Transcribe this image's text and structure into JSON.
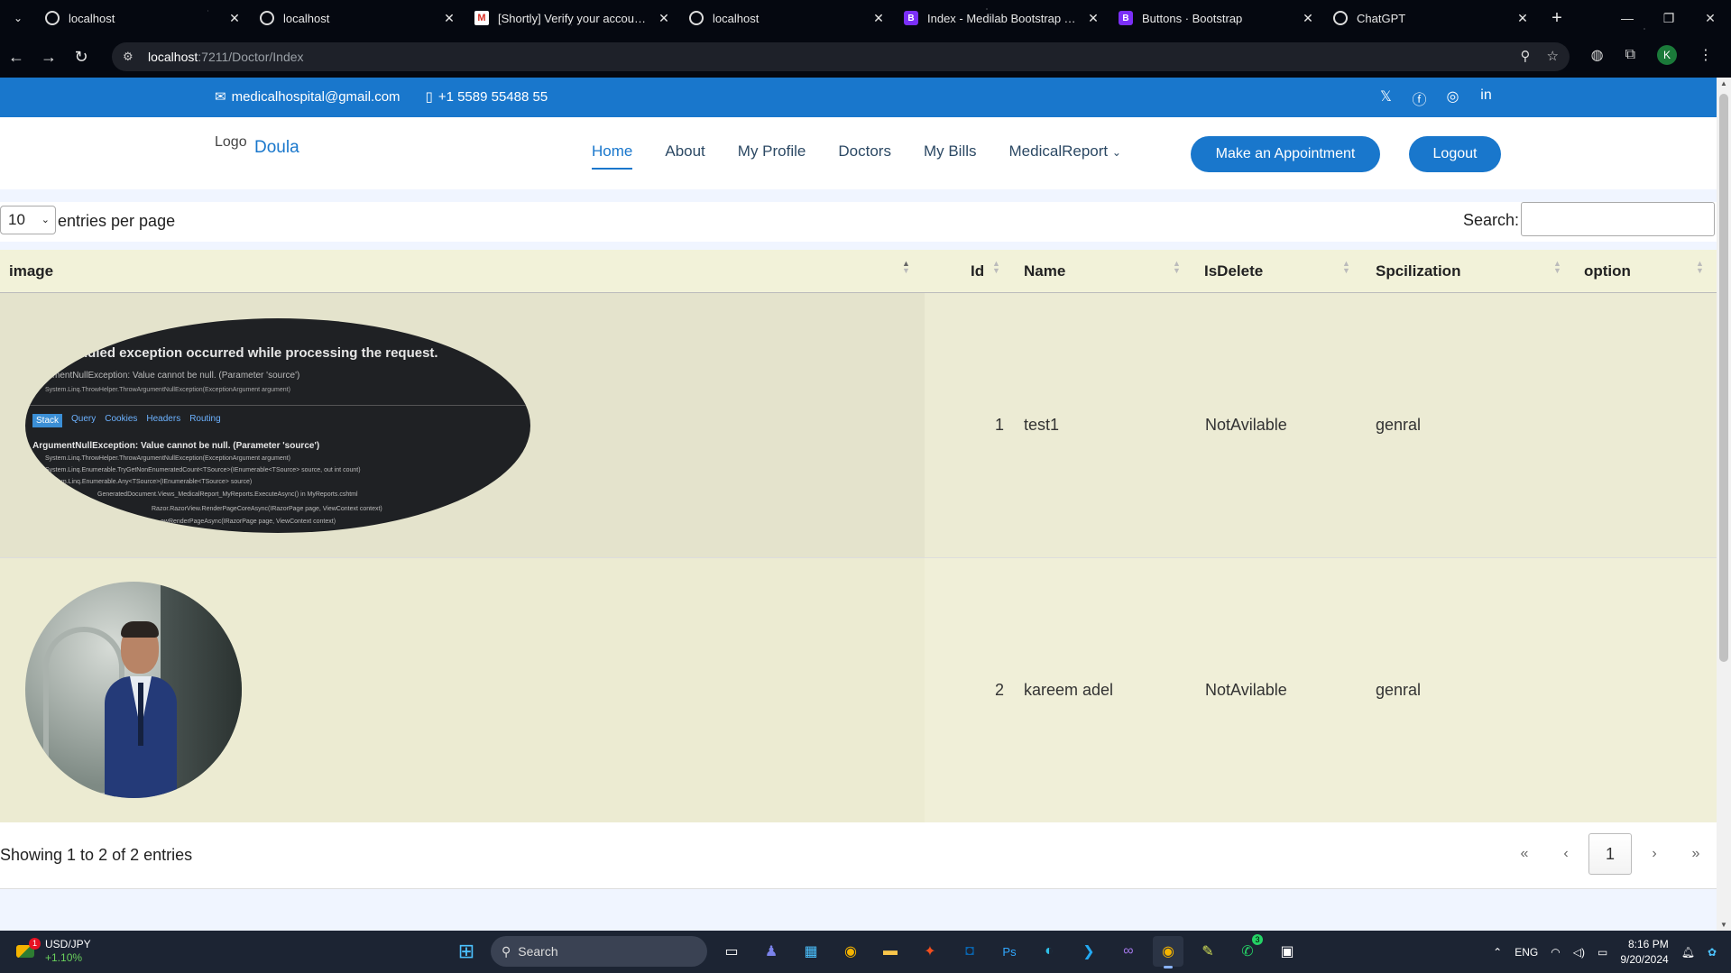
{
  "browser": {
    "tabs": [
      {
        "title": "localhost",
        "icon": "globe-icon"
      },
      {
        "title": "localhost",
        "icon": "globe-icon"
      },
      {
        "title": "[Shortly] Verify your account - ",
        "icon": "gmail-icon"
      },
      {
        "title": "localhost",
        "icon": "globe-icon"
      },
      {
        "title": "Index - Medilab Bootstrap Tem",
        "icon": "bootstrap-icon"
      },
      {
        "title": "Buttons · Bootstrap",
        "icon": "bootstrap-icon"
      },
      {
        "title": "ChatGPT",
        "icon": "chatgpt-icon"
      }
    ],
    "url_host": "localhost",
    "url_path": ":7211/Doctor/Index",
    "profile_initial": "K"
  },
  "topbar": {
    "email": "medicalhospital@gmail.com",
    "phone": "+1 5589 55488 55",
    "social": [
      "x-icon",
      "facebook-icon",
      "instagram-icon",
      "linkedin-icon"
    ]
  },
  "header": {
    "logo_alt": "Logo",
    "brand": "Doula",
    "nav": [
      "Home",
      "About",
      "My Profile",
      "Doctors",
      "My Bills",
      "MedicalReport"
    ],
    "appointment_button": "Make an Appointment",
    "logout_button": "Logout"
  },
  "table_controls": {
    "entries_value": "10",
    "entries_label": "entries per page",
    "search_label": "Search:",
    "search_value": ""
  },
  "table": {
    "columns": [
      "image",
      "Id",
      "Name",
      "IsDelete",
      "Spcilization",
      "option"
    ],
    "rows": [
      {
        "id": "1",
        "name": "test1",
        "isdelete": "NotAvilable",
        "specialization": "genral",
        "image": "error-page-screenshot"
      },
      {
        "id": "2",
        "name": "kareem adel",
        "isdelete": "NotAvilable",
        "specialization": "genral",
        "image": "doctor-photo"
      }
    ],
    "error_image_text": {
      "heading": "ndled exception occurred while processing the request.",
      "line1": "mentNullException: Value cannot be null. (Parameter 'source')",
      "line2": "System.Linq.ThrowHelper.ThrowArgumentNullException(ExceptionArgument argument)",
      "tabs": [
        "Stack",
        "Query",
        "Cookies",
        "Headers",
        "Routing"
      ],
      "exception": "ArgumentNullException: Value cannot be null. (Parameter 'source')",
      "trace1": "System.Linq.ThrowHelper.ThrowArgumentNullException(ExceptionArgument argument)",
      "trace2": "System.Linq.Enumerable.TryGetNonEnumeratedCount<TSource>(IEnumerable<TSource> source, out int count)",
      "trace3": "em.Linq.Enumerable.Any<TSource>(IEnumerable<TSource> source)",
      "trace4": "GeneratedDocument.Views_MedicalReport_MyReports.ExecuteAsync() in MyReports.cshtml",
      "trace5": "Razor.RazorView.RenderPageCoreAsync(IRazorPage page, ViewContext context)",
      "trace6": "ewRenderPageAsync(IRazorPage page, ViewContext context)"
    }
  },
  "footer_controls": {
    "info": "Showing 1 to 2 of 2 entries",
    "pager": [
      "«",
      "‹",
      "1",
      "›",
      "»"
    ]
  },
  "taskbar": {
    "ticker_symbol": "USD/JPY",
    "ticker_change": "+1.10%",
    "ticker_badge": "1",
    "search_placeholder": "Search",
    "language": "ENG",
    "time": "8:16 PM",
    "date": "9/20/2024",
    "whatsapp_badge": "3"
  },
  "colors": {
    "brand": "#1977cc",
    "table_header": "#f2f2d9",
    "taskbar": "#1c2433"
  }
}
